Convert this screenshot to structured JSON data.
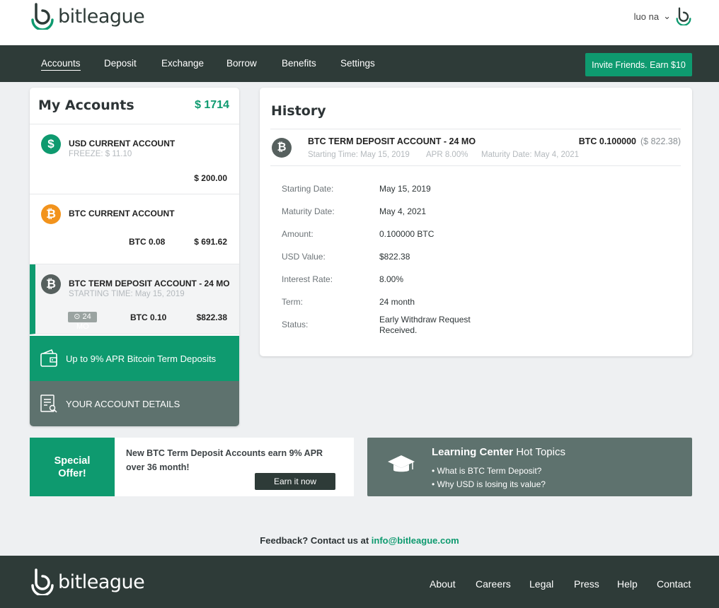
{
  "brand": {
    "bit": "bit",
    "league": "league"
  },
  "user": {
    "name": "luo na",
    "caret": "⌄"
  },
  "nav": {
    "items": [
      "Accounts",
      "Deposit",
      "Exchange",
      "Borrow",
      "Benefits",
      "Settings"
    ],
    "invite": "Invite Friends. Earn $10"
  },
  "accounts": {
    "title": "My Accounts",
    "total": "$ 1714",
    "items": [
      {
        "name": "USD CURRENT ACCOUNT",
        "sub": "FREEZE: $ 11.10",
        "usd": "$ 200.00",
        "icon": "dollar-icon",
        "symbol": "$"
      },
      {
        "name": "BTC CURRENT ACCOUNT",
        "btc": "BTC 0.08",
        "usd": "$ 691.62",
        "icon": "bitcoin-icon",
        "symbol": "₿"
      },
      {
        "name": "BTC TERM DEPOSIT ACCOUNT - 24 MO",
        "sub": "STARTING TIME: May 15, 2019",
        "badge": "⊙ 24",
        "badge_over": "MO",
        "btc": "BTC 0.10",
        "usd": "$822.38",
        "icon": "bitcoin-icon",
        "symbol": "₿"
      }
    ],
    "promo": "Up to 9% APR Bitcoin Term Deposits",
    "details": "YOUR ACCOUNT DETAILS"
  },
  "history": {
    "title": "History",
    "entry": {
      "name": "BTC TERM DEPOSIT ACCOUNT - 24 MO",
      "start": "Starting Time: May 15, 2019",
      "apr": "APR 8.00%",
      "maturity": "Maturity Date: May 4, 2021",
      "btc": "BTC 0.100000",
      "usd": "($ 822.38)"
    },
    "details": [
      {
        "label": "Starting Date:",
        "value": "May 15, 2019"
      },
      {
        "label": "Maturity Date:",
        "value": "May 4, 2021"
      },
      {
        "label": "Amount:",
        "value": "0.100000 BTC"
      },
      {
        "label": "USD Value:",
        "value": "$822.38"
      },
      {
        "label": "Interest Rate:",
        "value": "8.00%"
      },
      {
        "label": "Term:",
        "value": "24 month"
      },
      {
        "label": "Status:",
        "value": "Early Withdraw Request Received."
      }
    ]
  },
  "offer": {
    "label_line1": "Special",
    "label_line2": "Offer!",
    "text": "New BTC Term Deposit Accounts earn 9% APR over 36 month!",
    "button": "Earn it now"
  },
  "learn": {
    "title_bold": "Learning Center",
    "title_rest": "Hot Topics",
    "items": [
      "• What is BTC Term Deposit?",
      "• Why USD is losing its value?"
    ]
  },
  "feedback": {
    "text": "Feedback? Contact us at",
    "email": "info@bitleague.com"
  },
  "footer": {
    "links": [
      "About",
      "Careers",
      "Legal",
      "Press",
      "Help",
      "Contact"
    ]
  },
  "colors": {
    "brand_green": "#0e9a6f",
    "dark": "#2e3b38",
    "slate": "#5e726e",
    "btc_orange": "#f2931c"
  }
}
